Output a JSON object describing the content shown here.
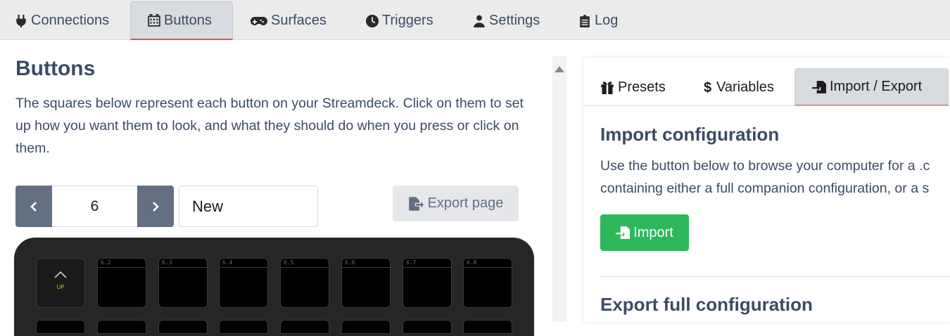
{
  "nav": {
    "tabs": [
      {
        "label": "Connections",
        "icon": "plug-icon"
      },
      {
        "label": "Buttons",
        "icon": "calendar-grid-icon",
        "active": true
      },
      {
        "label": "Surfaces",
        "icon": "gamepad-icon"
      },
      {
        "label": "Triggers",
        "icon": "clock-icon"
      },
      {
        "label": "Settings",
        "icon": "user-gear-icon"
      },
      {
        "label": "Log",
        "icon": "clipboard-list-icon"
      }
    ]
  },
  "buttons": {
    "title": "Buttons",
    "description": "The squares below represent each button on your Streamdeck. Click on them to set up how you want them to look, and what they should do when you press or click on them.",
    "page_number": "6",
    "page_name": "New",
    "export_page_label": "Export page",
    "keys": [
      {
        "label": "",
        "text": "UP",
        "icon": "chevron-up-icon"
      },
      {
        "label": "6.2"
      },
      {
        "label": "6.3"
      },
      {
        "label": "6.4"
      },
      {
        "label": "6.5"
      },
      {
        "label": "6.6"
      },
      {
        "label": "6.7"
      },
      {
        "label": "6.8"
      }
    ]
  },
  "right_panel": {
    "tabs": [
      {
        "label": "Presets",
        "icon": "gift-icon"
      },
      {
        "label": "Variables",
        "icon": "dollar-icon"
      },
      {
        "label": "Import / Export",
        "icon": "file-import-icon",
        "active": true
      }
    ],
    "import_title": "Import configuration",
    "import_text_line1": "Use the button below to browse your computer for a .c",
    "import_text_line2": "containing either a full companion configuration, or a s",
    "import_button_label": "Import",
    "export_title": "Export full configuration"
  },
  "colors": {
    "accent_tab_underline": "#e55353",
    "import_button": "#2eb85c",
    "pager_button": "#636f83",
    "deck_body": "#262626",
    "up_text": "#f0b400"
  }
}
